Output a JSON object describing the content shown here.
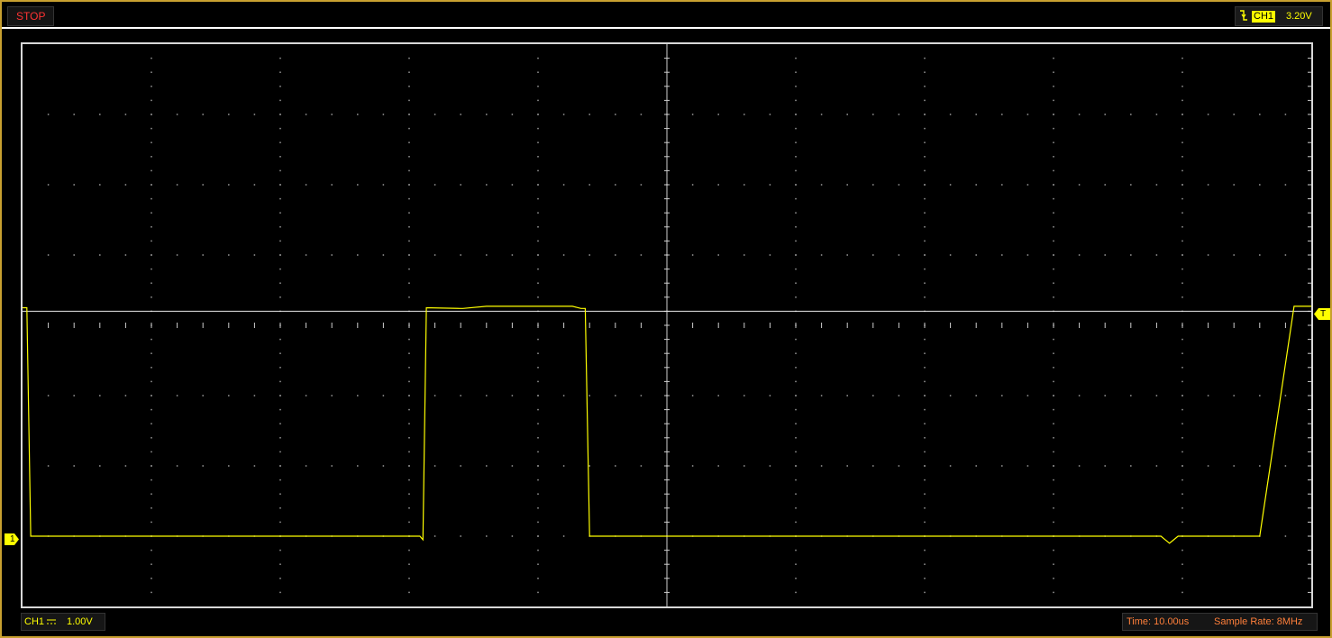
{
  "status": {
    "run_state": "STOP"
  },
  "trigger": {
    "channel": "CH1",
    "level": "3.20V",
    "edge": "falling",
    "marker": "T"
  },
  "channel1": {
    "label": "CH1",
    "volts_per_div": "1.00V",
    "coupling": "DC",
    "marker": "1",
    "color": "#ffff00"
  },
  "timebase": {
    "time_label": "Time: 10.00us",
    "sample_rate_label": "Sample Rate: 8MHz"
  },
  "colors": {
    "frame": "#c8a030",
    "stop": "#ff3333",
    "timebase": "#ff7f3a",
    "trace": "#ffff00"
  },
  "chart_data": {
    "type": "line",
    "series": [
      {
        "name": "CH1",
        "x_div": [
          0,
          0.1,
          0.19,
          9.15,
          9.25,
          9.32,
          9.4,
          10.2,
          10.25,
          10.8,
          12.8,
          13.0,
          13.1,
          13.2,
          26.5,
          26.6,
          26.7,
          26.8,
          26.9,
          27.05,
          28.8,
          29.6,
          29.7,
          30.0
        ],
        "y_div": [
          0.25,
          0.25,
          -3.0,
          -3.0,
          -3.0,
          -3.05,
          0.25,
          0.24,
          0.24,
          0.27,
          0.27,
          0.24,
          0.24,
          -3.0,
          -3.0,
          -3.05,
          -3.1,
          -3.05,
          -3.0,
          -3.0,
          -3.0,
          0.27,
          0.27,
          0.27
        ]
      }
    ],
    "x_divisions": 30,
    "y_divisions": 8,
    "xlim": [
      0,
      30
    ],
    "ylim": [
      -4,
      4
    ],
    "ground_level_div": -3,
    "trigger_level_div": 0.2,
    "grid": true
  }
}
